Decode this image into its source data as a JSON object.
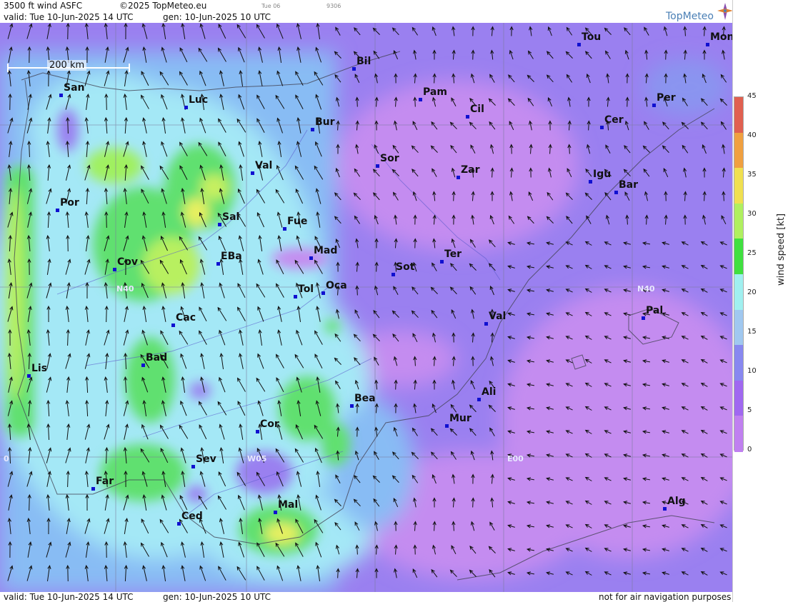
{
  "header": {
    "title": "3500 ft wind ASFC",
    "copyright": "©2025 TopMeteo.eu",
    "run_small": "Tue 06",
    "code_small": "9306",
    "valid": "valid:  Tue  10-Jun-2025  14 UTC",
    "gen": "gen: 10-Jun-2025 10 UTC",
    "logo": "TopMeteo"
  },
  "footer": {
    "valid": "valid:  Tue  10-Jun-2025  14 UTC",
    "gen": "gen: 10-Jun-2025 10 UTC",
    "disclaimer": "not for air navigation purposes"
  },
  "scale": {
    "label": "200 km"
  },
  "grid_labels": {
    "n40_west": "N40",
    "n40_east": "N40",
    "w05": "W05",
    "e00": "E00",
    "w10": "0"
  },
  "legend": {
    "title": "wind speed [kt]",
    "ticks": [
      "45",
      "40",
      "35",
      "30",
      "25",
      "20",
      "15",
      "10",
      "5",
      "0"
    ],
    "colors": [
      "#e06050",
      "#f0a040",
      "#f0e050",
      "#b0f060",
      "#40e040",
      "#a0f0f0",
      "#a0c8f0",
      "#8888f0",
      "#a068f0",
      "#c080f0"
    ]
  },
  "cities": [
    {
      "name": "San"
    },
    {
      "name": "Luc"
    },
    {
      "name": "Bil"
    },
    {
      "name": "Pam"
    },
    {
      "name": "Cil"
    },
    {
      "name": "Tou"
    },
    {
      "name": "Mon"
    },
    {
      "name": "Per"
    },
    {
      "name": "Cer"
    },
    {
      "name": "Bur"
    },
    {
      "name": "Sor"
    },
    {
      "name": "Zar"
    },
    {
      "name": "Igu"
    },
    {
      "name": "Bar"
    },
    {
      "name": "Val"
    },
    {
      "name": "Por"
    },
    {
      "name": "Sal"
    },
    {
      "name": "Fue"
    },
    {
      "name": "Cov"
    },
    {
      "name": "EBa"
    },
    {
      "name": "Mad"
    },
    {
      "name": "Ter"
    },
    {
      "name": "Sot"
    },
    {
      "name": "Tol"
    },
    {
      "name": "Oca"
    },
    {
      "name": "Pal"
    },
    {
      "name": "Cac"
    },
    {
      "name": "Val"
    },
    {
      "name": "Bad"
    },
    {
      "name": "Lis"
    },
    {
      "name": "Ali"
    },
    {
      "name": "Bea"
    },
    {
      "name": "Mur"
    },
    {
      "name": "Cor"
    },
    {
      "name": "Sev"
    },
    {
      "name": "Far"
    },
    {
      "name": "Mal"
    },
    {
      "name": "Alg"
    },
    {
      "name": "Ced"
    }
  ]
}
